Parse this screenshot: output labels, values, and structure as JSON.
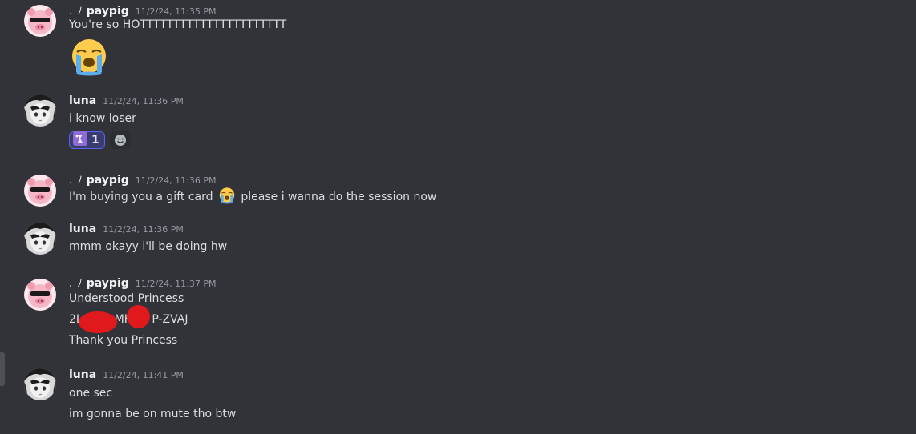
{
  "messages": [
    {
      "author_deco": ". ﾉ",
      "author": "paypig",
      "timestamp": "11/2/24, 11:35 PM",
      "lines": [
        "You're so HOTTTTTTTTTTTTTTTTTTTTTT"
      ],
      "big_emoji": "loudly-crying-face",
      "avatar": "pig-with-sunglasses"
    },
    {
      "author": "luna",
      "timestamp": "11/2/24, 11:36 PM",
      "lines": [
        "i know loser"
      ],
      "avatar": "anime-girl-monochrome",
      "reactions": [
        {
          "emoji": "custom-purple-emote",
          "count": "1"
        }
      ]
    },
    {
      "author_deco": ". ﾉ",
      "author": "paypig",
      "timestamp": "11/2/24, 11:36 PM",
      "line_before_emoji": "I'm buying you a gift card",
      "inline_emoji": "loudly-crying-face",
      "line_after_emoji": "please i wanna do the session now",
      "avatar": "pig-with-sunglasses"
    },
    {
      "author": "luna",
      "timestamp": "11/2/24, 11:36 PM",
      "lines": [
        "mmm okayy i'll be doing hw"
      ],
      "avatar": "anime-girl-monochrome"
    },
    {
      "author_deco": ". ﾉ",
      "author": "paypig",
      "timestamp": "11/2/24, 11:37 PM",
      "lines": [
        "Understood Princess",
        "2L MH P-ZVAJ",
        "Thank you Princess"
      ],
      "code_parts": [
        "2L",
        "MH",
        "P-ZVAJ"
      ],
      "avatar": "pig-with-sunglasses"
    },
    {
      "author": "luna",
      "timestamp": "11/2/24, 11:41 PM",
      "lines": [
        "one sec",
        "im gonna be on mute tho btw"
      ],
      "avatar": "anime-girl-monochrome"
    }
  ],
  "colors": {
    "background": "#323338",
    "username": "#f2f3f5",
    "timestamp": "#949ba4",
    "text": "#dbdee1",
    "reaction_bg": "#3a3c6e",
    "reaction_border": "#5865f2",
    "redaction": "#e0191c"
  }
}
